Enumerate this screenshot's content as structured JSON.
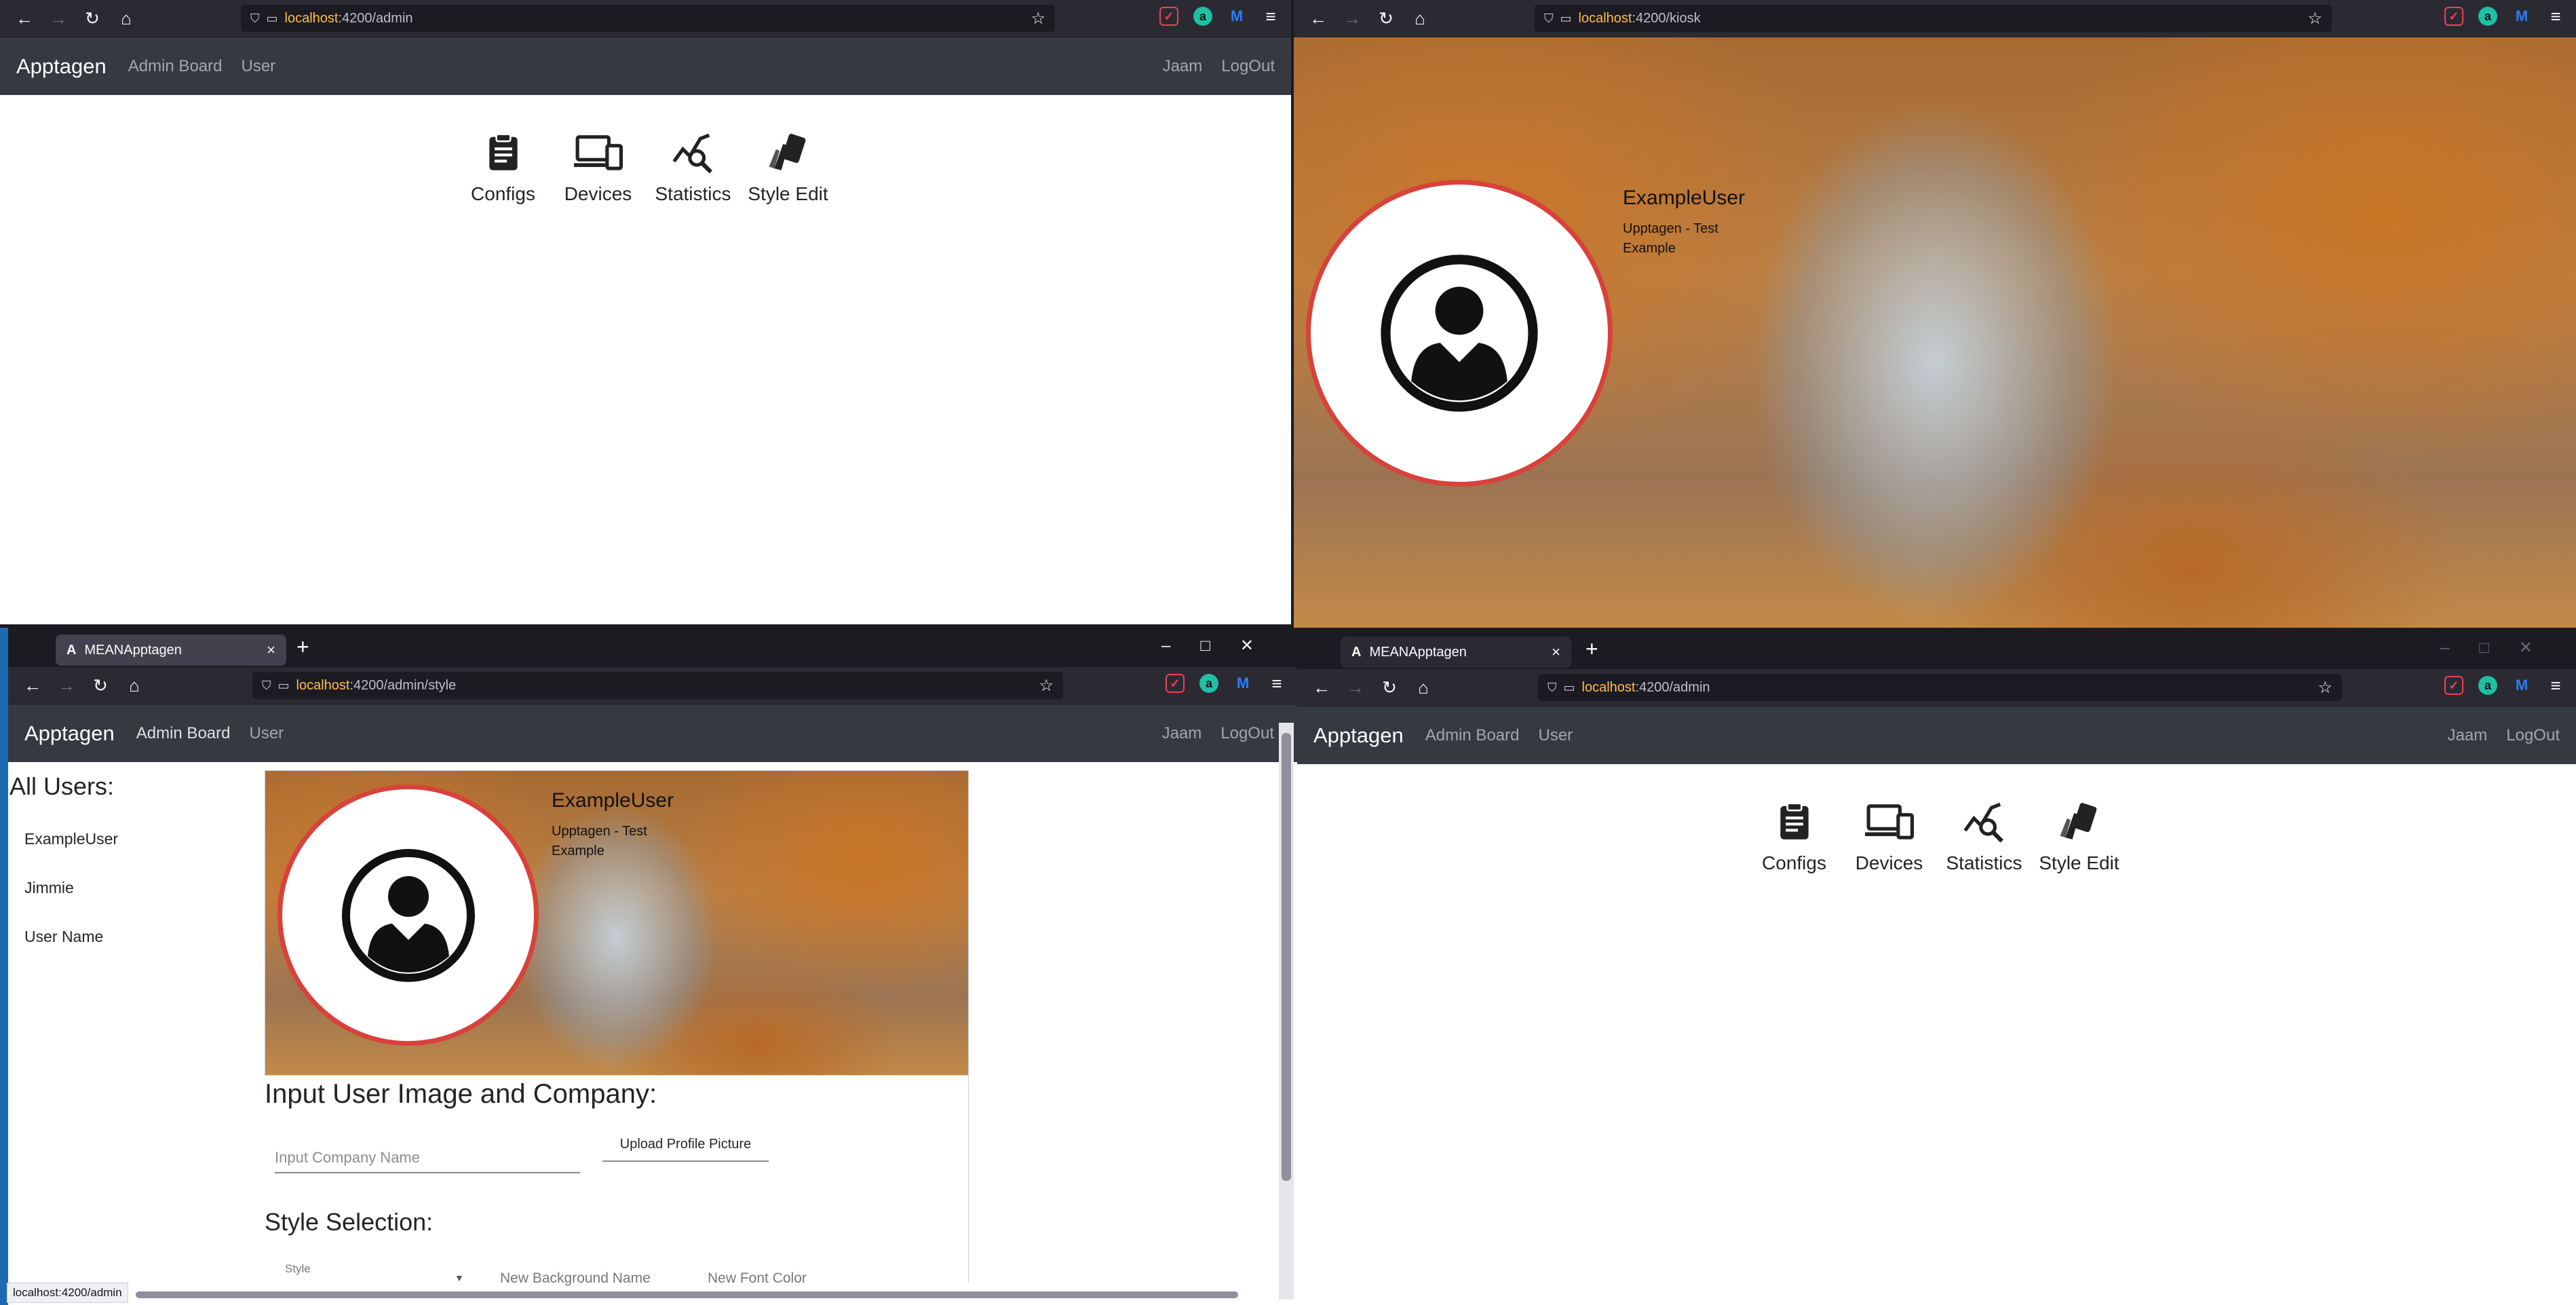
{
  "browser_url_host": "localhost",
  "windows": {
    "top_left": {
      "url_host": "localhost",
      "url_path": ":4200/admin"
    },
    "top_right": {
      "url_host": "localhost",
      "url_path": ":4200/kiosk"
    },
    "bottom_left": {
      "tab_title": "MEANApptagen",
      "url_host": "localhost",
      "url_path": ":4200/admin/style"
    },
    "bottom_right": {
      "tab_title": "MEANApptagen",
      "url_host": "localhost",
      "url_path": ":4200/admin"
    }
  },
  "navbar": {
    "brand": "Apptagen",
    "links": [
      "Admin Board",
      "User"
    ],
    "right_links": [
      "Jaam",
      "LogOut"
    ]
  },
  "admin_cards": [
    {
      "label": "Configs",
      "icon": "clipboard-icon"
    },
    {
      "label": "Devices",
      "icon": "devices-icon"
    },
    {
      "label": "Statistics",
      "icon": "statistics-icon"
    },
    {
      "label": "Style Edit",
      "icon": "style-edit-icon"
    }
  ],
  "kiosk": {
    "user_name": "ExampleUser",
    "company_line1": "Upptagen - Test",
    "company_line2": "Example"
  },
  "style_page": {
    "users_title": "All Users:",
    "users": [
      "ExampleUser",
      "Jimmie",
      "User Name"
    ],
    "input_section_title": "Input User Image and Company:",
    "company_placeholder": "Input Company Name",
    "upload_button": "Upload Profile Picture",
    "style_section_title": "Style Selection:",
    "style_select_label": "Style",
    "bg_name_placeholder": "New Background Name",
    "font_color_placeholder": "New Font Color"
  },
  "status_url": "localhost:4200/admin",
  "colors": {
    "navbar_bg": "#343a40",
    "avatar_border": "#d9413b",
    "url_host": "#ffbd4f"
  }
}
